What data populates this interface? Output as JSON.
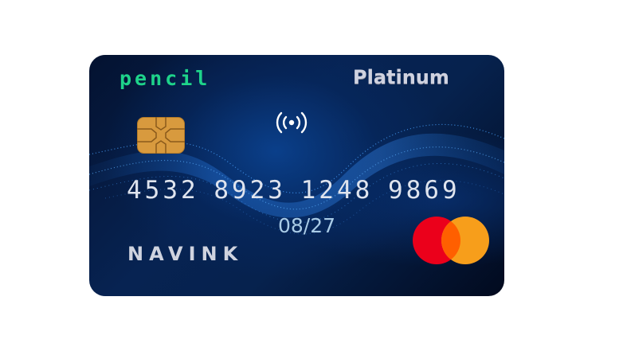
{
  "card": {
    "brand": "pencil",
    "tier": "Platinum",
    "number": "4532 8923 1248 9869",
    "expiry": "08/27",
    "holder": "NAVINK",
    "network": "mastercard-logo"
  },
  "colors": {
    "brand": "#1ed38a",
    "tier": "#cfd2e0",
    "number": "#dfe4ee",
    "expiry": "#a9cbe6",
    "holder": "#cfd3df",
    "card_bg": "#072352",
    "chip": "#d89a3e",
    "mc_red": "#eb001b",
    "mc_orange": "#f79e1b"
  },
  "icons": [
    "emv-chip-icon",
    "contactless-icon",
    "mastercard-logo"
  ]
}
